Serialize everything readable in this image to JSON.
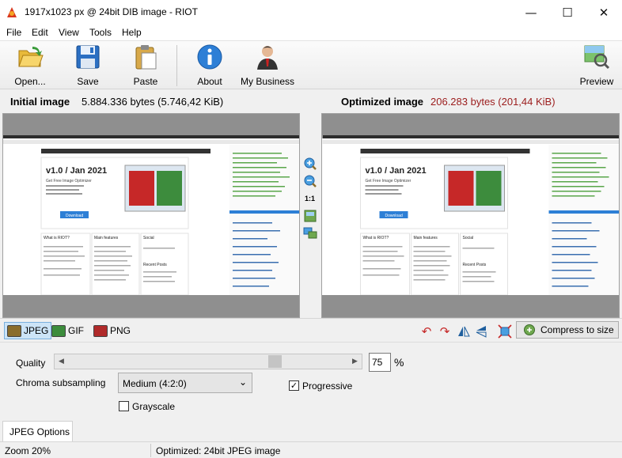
{
  "window": {
    "title": "1917x1023 px @ 24bit  DIB image - RIOT",
    "minimize_glyph": "—",
    "maximize_glyph": "☐",
    "close_glyph": "✕"
  },
  "menu": [
    "File",
    "Edit",
    "View",
    "Tools",
    "Help"
  ],
  "toolbar": {
    "open": "Open...",
    "save": "Save",
    "paste": "Paste",
    "about": "About",
    "business": "My Business",
    "preview": "Preview"
  },
  "info": {
    "initial_label": "Initial image",
    "initial_value": "5.884.336 bytes (5.746,42 KiB)",
    "optimized_label": "Optimized image",
    "optimized_value": "206.283 bytes (201,44 KiB)",
    "optimized_color": "#9b1c1c"
  },
  "zoom_controls": {
    "one_to_one": "1:1"
  },
  "screenshot_content": {
    "headline": "v1.0 / Jan 2021",
    "subheadline": "Get Free Image Optimizer",
    "download": "Download",
    "what_is": "What is RIOT?",
    "main_features": "Main features",
    "social": "Social",
    "recent_posts": "Recent Posts"
  },
  "formats": {
    "jpeg": "JPEG",
    "gif": "GIF",
    "png": "PNG",
    "active": "JPEG",
    "compress_label": "Compress to size"
  },
  "options": {
    "quality_label": "Quality",
    "quality_value": "75",
    "quality_unit": "%",
    "quality_fraction": 0.75,
    "chroma_label": "Chroma subsampling",
    "chroma_value": "Medium (4:2:0)",
    "progressive_label": "Progressive",
    "progressive_checked": true,
    "grayscale_label": "Grayscale",
    "grayscale_checked": false,
    "checkmark": "✓"
  },
  "options_tab": "JPEG Options",
  "status": {
    "zoom": "Zoom 20%",
    "message": "Optimized: 24bit JPEG image"
  }
}
